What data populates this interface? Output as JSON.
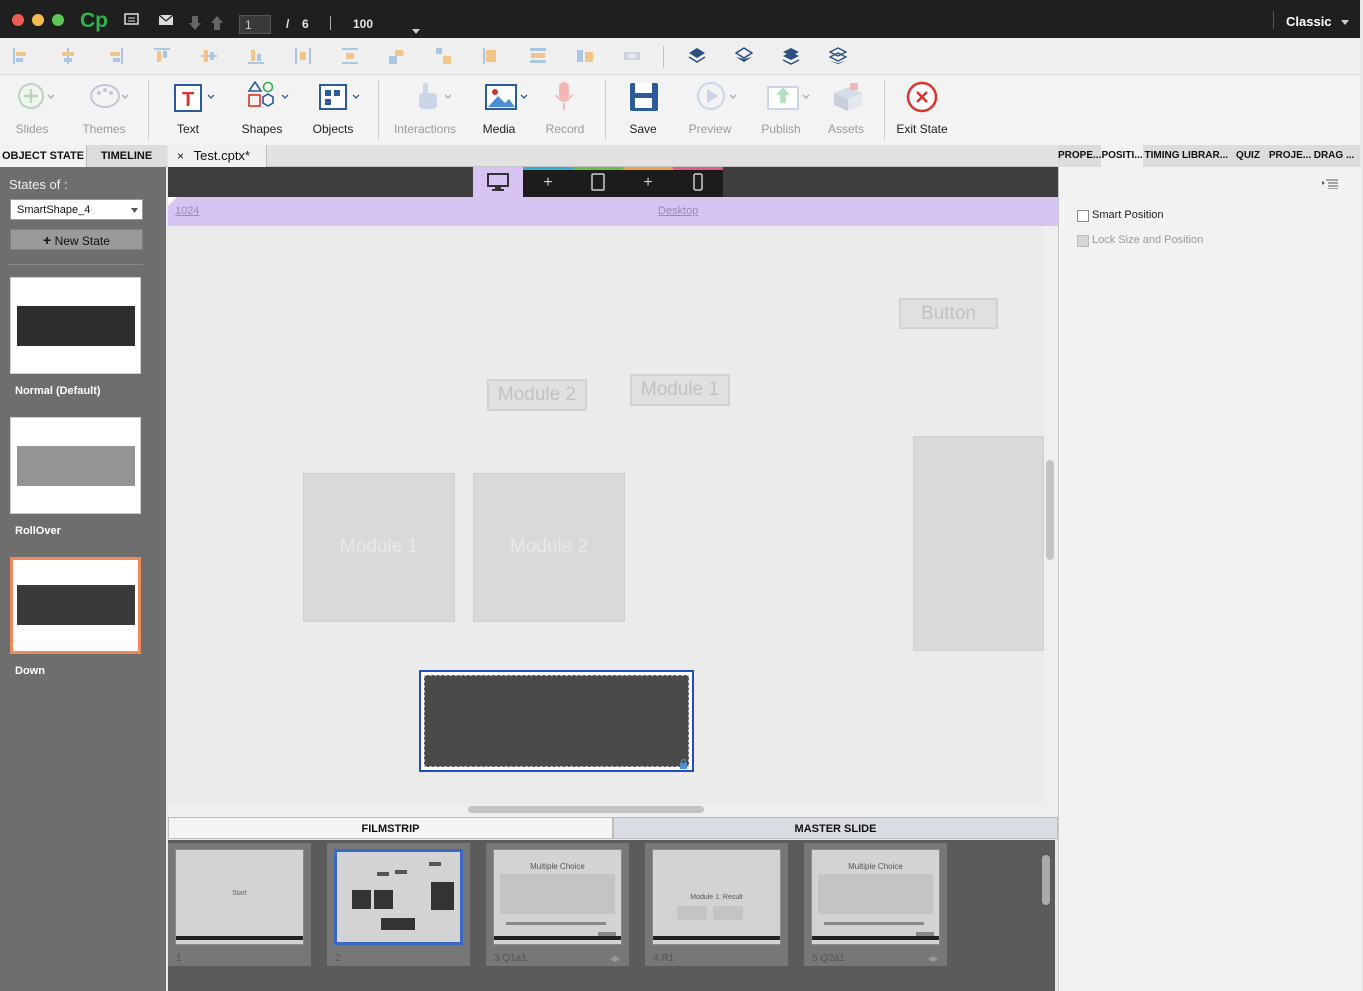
{
  "titlebar": {
    "app_logo": "Cp",
    "slide_current": "1",
    "slide_separator": "/",
    "slide_total": "6",
    "zoom": "100",
    "workspace": "Classic"
  },
  "main_toolbar": {
    "slides": "Slides",
    "themes": "Themes",
    "text": "Text",
    "shapes": "Shapes",
    "objects": "Objects",
    "interactions": "Interactions",
    "media": "Media",
    "record": "Record",
    "save": "Save",
    "preview": "Preview",
    "publish": "Publish",
    "assets": "Assets",
    "exit_state": "Exit State"
  },
  "left_panel": {
    "tabs": [
      "OBJECT STATE",
      "TIMELINE"
    ],
    "states_of_label": "States of :",
    "selected_object": "SmartShape_4",
    "new_state": "New State",
    "states": [
      {
        "name": "Normal (Default)"
      },
      {
        "name": "RollOver"
      },
      {
        "name": "Down"
      }
    ]
  },
  "document": {
    "tab_close": "×",
    "tab_title": "Test.cptx*"
  },
  "canvas": {
    "ruler_value": "1024",
    "breakpoint_label": "Desktop",
    "ghost_button": "Button",
    "ghost_module2_btn": "Module 2",
    "ghost_module1_btn": "Module 1",
    "ghost_module1_box": "Module 1",
    "ghost_module2_box": "Module 2"
  },
  "filmstrip": {
    "tabs": [
      "FILMSTRIP",
      "MASTER SLIDE"
    ],
    "slides": [
      {
        "num": "1",
        "caption": "Start"
      },
      {
        "num": "2",
        "caption": ""
      },
      {
        "num": "3 Q1a1",
        "caption": "Multiple Choice"
      },
      {
        "num": "4 R1",
        "caption": "Module 1: Result"
      },
      {
        "num": "5 Q2a1",
        "caption": "Multiple Choice"
      }
    ]
  },
  "right_panel": {
    "tabs": [
      "PROPE...",
      "POSITI...",
      "TIMING",
      "LIBRAR...",
      "QUIZ",
      "PROJE...",
      "DRAG ..."
    ],
    "smart_position": "Smart Position",
    "lock_size_position": "Lock Size and Position"
  },
  "colors": {
    "selection_accent": "#f08a5a",
    "breakpoint_ruler": "#d8c3f5",
    "selection_outline": "#1f4fbf"
  }
}
